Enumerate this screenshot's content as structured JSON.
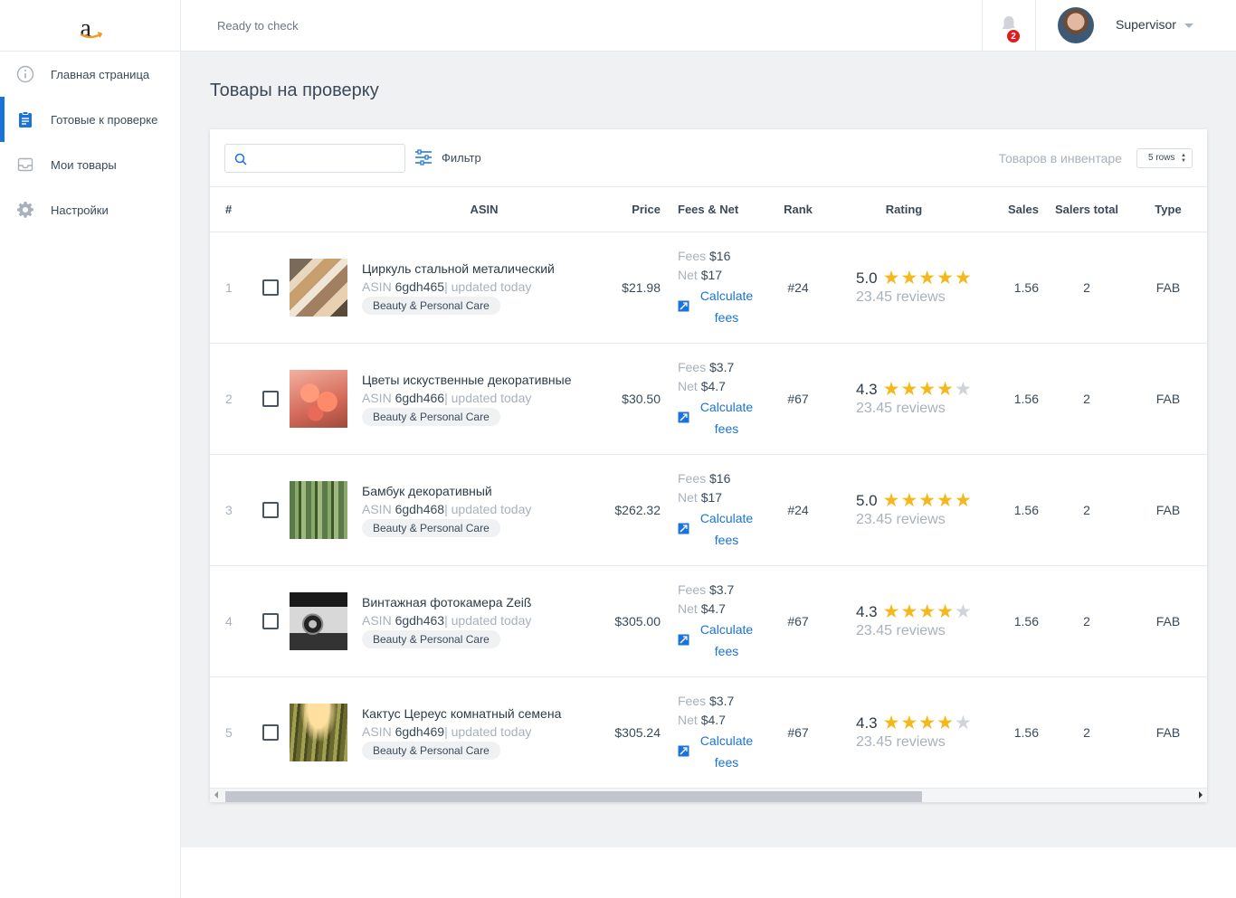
{
  "sidebar": {
    "logo": "a",
    "items": [
      {
        "label": "Главная страница",
        "icon": "info-icon",
        "active": false
      },
      {
        "label": "Готовые к проверке",
        "icon": "clipboard-icon",
        "active": true
      },
      {
        "label": "Мои товары",
        "icon": "inbox-icon",
        "active": false
      },
      {
        "label": "Настройки",
        "icon": "gear-icon",
        "active": false
      }
    ]
  },
  "topbar": {
    "status": "Ready to check",
    "notifications": "2",
    "user": "Supervisor"
  },
  "page_title": "Товары на проверку",
  "toolbar": {
    "search_placeholder": "",
    "filter_label": "Фильтр",
    "inventory_label": "Товаров в инвентаре",
    "rows_label": "5 rows"
  },
  "columns": [
    "#",
    "ASIN",
    "Price",
    "Fees & Net",
    "Rank",
    "Rating",
    "Sales",
    "Salers total",
    "Type"
  ],
  "rows": [
    {
      "num": "1",
      "name": "Циркуль стальной металический",
      "asin_label": "ASIN",
      "asin": "6gdh465",
      "updated": "| updated today",
      "category": "Beauty & Personal Care",
      "price": "$21.98",
      "fees_label": "Fees",
      "fees": "$16",
      "net_label": "Net",
      "net": "$17",
      "calc": "Calculate fees",
      "rank": "#24",
      "rating": "5.0",
      "stars": 5,
      "reviews": "23.45 reviews",
      "sales": "1.56",
      "salers": "2",
      "type": "FAB",
      "img": "pencils"
    },
    {
      "num": "2",
      "name": "Цветы искуственные декоративные",
      "asin_label": "ASIN",
      "asin": "6gdh466",
      "updated": "| updated today",
      "category": "Beauty & Personal Care",
      "price": "$30.50",
      "fees_label": "Fees",
      "fees": "$3.7",
      "net_label": "Net",
      "net": "$4.7",
      "calc": "Calculate fees",
      "rank": "#67",
      "rating": "4.3",
      "stars": 4,
      "reviews": "23.45 reviews",
      "sales": "1.56",
      "salers": "2",
      "type": "FAB",
      "img": "flowers"
    },
    {
      "num": "3",
      "name": "Бамбук декоративный",
      "asin_label": "ASIN",
      "asin": "6gdh468",
      "updated": "| updated today",
      "category": "Beauty & Personal Care",
      "price": "$262.32",
      "fees_label": "Fees",
      "fees": "$16",
      "net_label": "Net",
      "net": "$17",
      "calc": "Calculate fees",
      "rank": "#24",
      "rating": "5.0",
      "stars": 5,
      "reviews": "23.45 reviews",
      "sales": "1.56",
      "salers": "2",
      "type": "FAB",
      "img": "bamboo"
    },
    {
      "num": "4",
      "name": "Винтажная фотокамера Zeiß",
      "asin_label": "ASIN",
      "asin": "6gdh463",
      "updated": "| updated today",
      "category": "Beauty & Personal Care",
      "price": "$305.00",
      "fees_label": "Fees",
      "fees": "$3.7",
      "net_label": "Net",
      "net": "$4.7",
      "calc": "Calculate fees",
      "rank": "#67",
      "rating": "4.3",
      "stars": 4,
      "reviews": "23.45 reviews",
      "sales": "1.56",
      "salers": "2",
      "type": "FAB",
      "img": "camera"
    },
    {
      "num": "5",
      "name": "Кактус Цереус комнатный семена",
      "asin_label": "ASIN",
      "asin": "6gdh469",
      "updated": "| updated today",
      "category": "Beauty & Personal Care",
      "price": "$305.24",
      "fees_label": "Fees",
      "fees": "$3.7",
      "net_label": "Net",
      "net": "$4.7",
      "calc": "Calculate fees",
      "rank": "#67",
      "rating": "4.3",
      "stars": 4,
      "reviews": "23.45 reviews",
      "sales": "1.56",
      "salers": "2",
      "type": "FAB",
      "img": "cactus"
    }
  ],
  "colors": {
    "accent": "#1a73d9",
    "star": "#f5b81c",
    "badge": "#e21b1b"
  }
}
